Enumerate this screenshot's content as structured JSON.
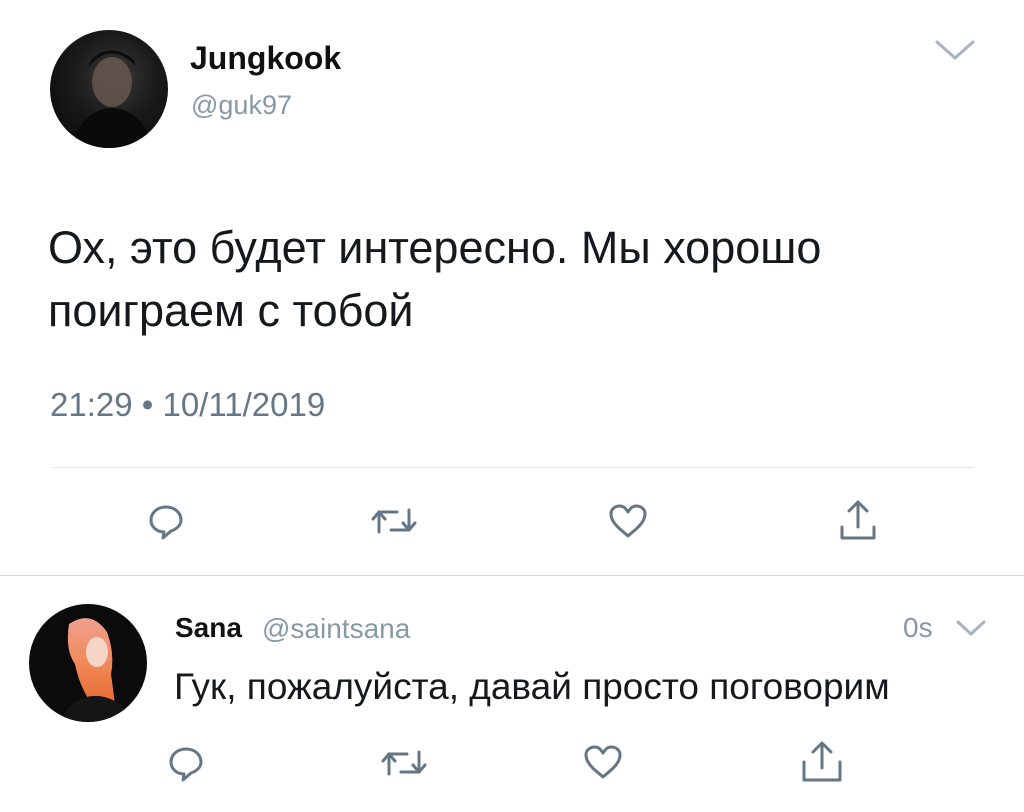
{
  "tweet": {
    "author": {
      "name": "Jungkook",
      "handle": "@guk97"
    },
    "text": "Ох, это будет интересно. Мы хорошо поиграем с тобой",
    "timestamp": "21:29 • 10/11/2019",
    "actions": {
      "reply_icon": "speech-bubble-icon",
      "retweet_icon": "retweet-icon",
      "like_icon": "heart-icon",
      "share_icon": "share-icon"
    }
  },
  "reply": {
    "author": {
      "name": "Sana",
      "handle": "@saintsana"
    },
    "time": "0s",
    "text": "Гук, пожалуйста, давай просто поговорим"
  },
  "colors": {
    "icon": "#657786",
    "secondary_text": "#8899a6",
    "divider": "#e1e8ed"
  }
}
